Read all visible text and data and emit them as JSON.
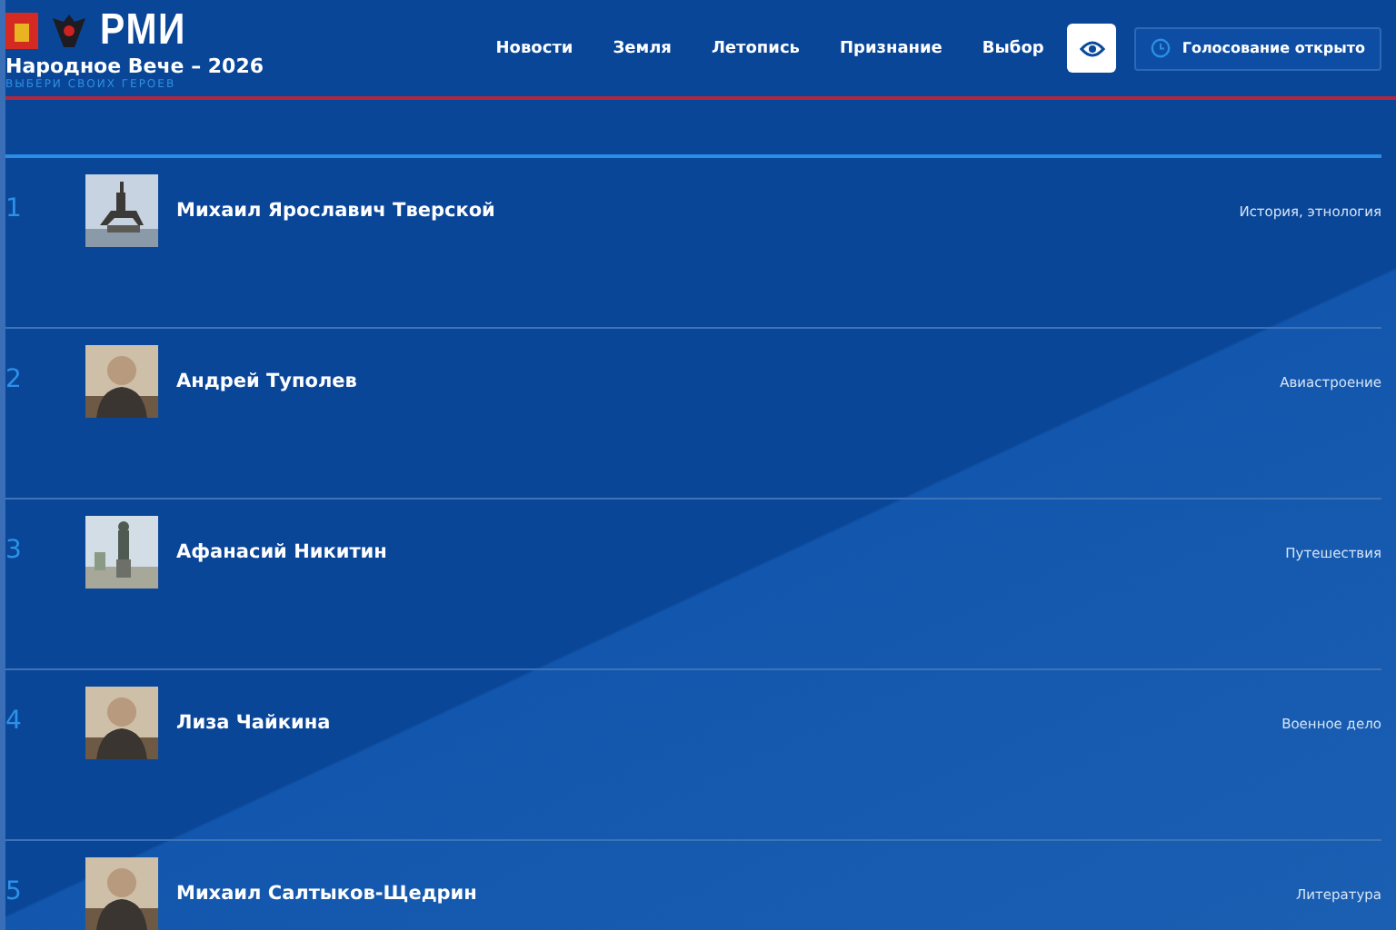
{
  "header": {
    "logo_text": "РМИ",
    "title": "Народное Вече – 2026",
    "subtitle": "ВЫБЕРИ СВОИХ ГЕРОЕВ"
  },
  "nav": [
    {
      "label": "Новости"
    },
    {
      "label": "Земля"
    },
    {
      "label": "Летопись"
    },
    {
      "label": "Признание"
    },
    {
      "label": "Выбор"
    }
  ],
  "status_button": {
    "label": "Голосование открыто"
  },
  "heroes": [
    {
      "number": "1",
      "name": "Михаил Ярославич Тверской",
      "category": "История, этнология"
    },
    {
      "number": "2",
      "name": "Андрей Туполев",
      "category": "Авиастроение"
    },
    {
      "number": "3",
      "name": "Афанасий Никитин",
      "category": "Путешествия"
    },
    {
      "number": "4",
      "name": "Лиза Чайкина",
      "category": "Военное дело"
    },
    {
      "number": "5",
      "name": "Михаил Салтыков-Щедрин",
      "category": "Литература"
    }
  ]
}
